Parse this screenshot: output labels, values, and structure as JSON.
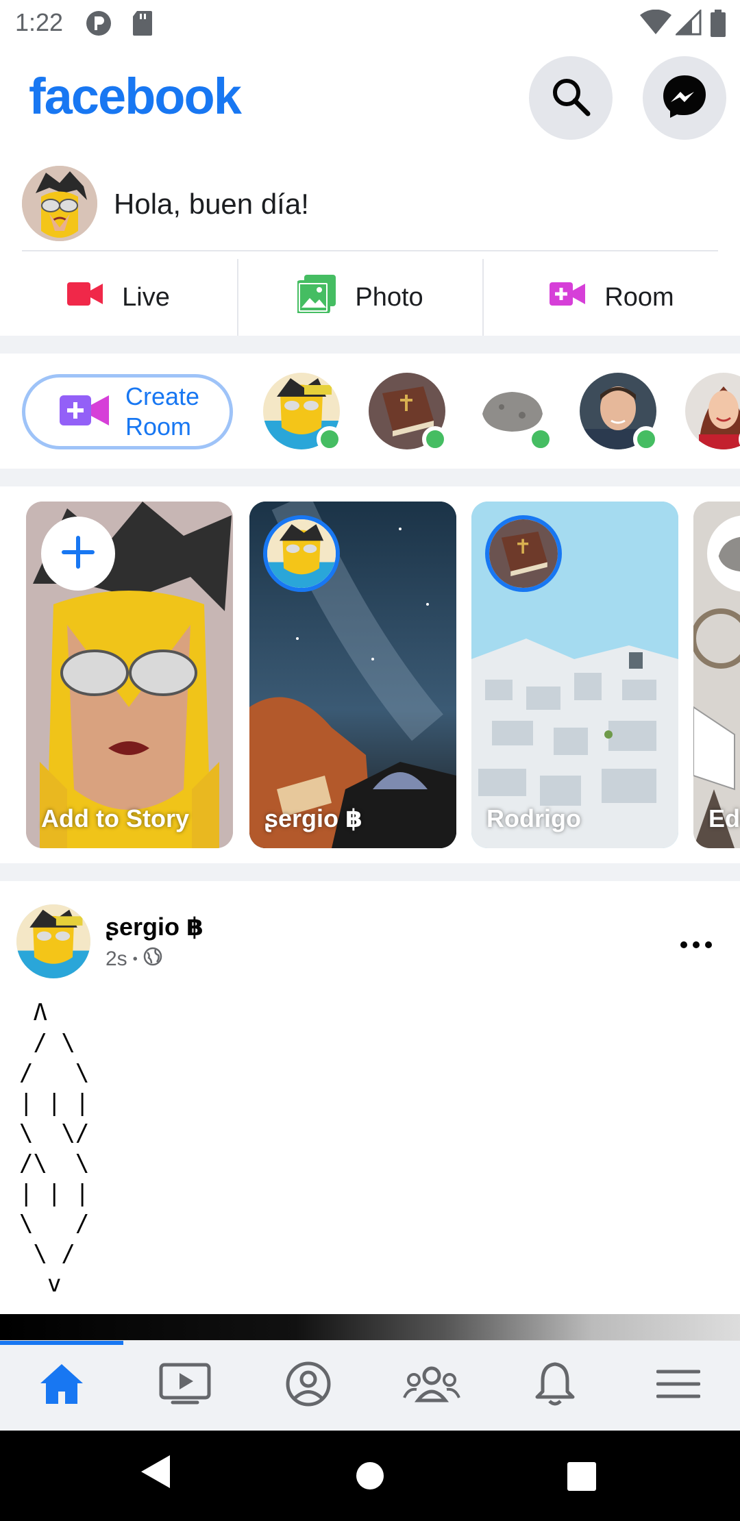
{
  "status_bar": {
    "time": "1:22",
    "icons": [
      "p-circle-icon",
      "sd-card-icon",
      "wifi-icon",
      "signal-icon",
      "battery-icon"
    ]
  },
  "header": {
    "logo": "facebook",
    "search_icon": "search-icon",
    "messenger_icon": "messenger-icon",
    "brand_color": "#1877f2"
  },
  "composer": {
    "prompt": "Hola, buen día!",
    "actions": [
      {
        "label": "Live",
        "icon": "live-video-icon",
        "color": "#f02849"
      },
      {
        "label": "Photo",
        "icon": "photo-icon",
        "color": "#45bd62"
      },
      {
        "label": "Room",
        "icon": "room-icon",
        "color": "#d63fd8"
      }
    ]
  },
  "rooms": {
    "create_label_line1": "Create",
    "create_label_line2": "Room",
    "contacts": [
      {
        "avatar": "cartoon-avatar",
        "online": true
      },
      {
        "avatar": "book-avatar",
        "online": true
      },
      {
        "avatar": "rock-avatar",
        "online": true
      },
      {
        "avatar": "man-avatar",
        "online": true
      },
      {
        "avatar": "woman-avatar",
        "online": true
      }
    ]
  },
  "stories": [
    {
      "name": "Add to Story",
      "type": "add"
    },
    {
      "name": "ʂergio ฿"
    },
    {
      "name": "Rodrigo"
    },
    {
      "name": "Edu"
    }
  ],
  "post": {
    "author": "ʂergio ฿",
    "time": "2s",
    "separator": "•",
    "privacy_icon": "globe-icon",
    "body": " Λ\n / \\\n/   \\\n| | |\n\\  \\/\n/\\  \\\n| | |\n\\   /\n \\ /\n  v"
  },
  "tabs": [
    {
      "name": "home",
      "icon": "home-icon",
      "active": true
    },
    {
      "name": "watch",
      "icon": "video-icon",
      "active": false
    },
    {
      "name": "profile",
      "icon": "profile-icon",
      "active": false
    },
    {
      "name": "groups",
      "icon": "groups-icon",
      "active": false
    },
    {
      "name": "notifications",
      "icon": "bell-icon",
      "active": false
    },
    {
      "name": "menu",
      "icon": "menu-icon",
      "active": false
    }
  ]
}
